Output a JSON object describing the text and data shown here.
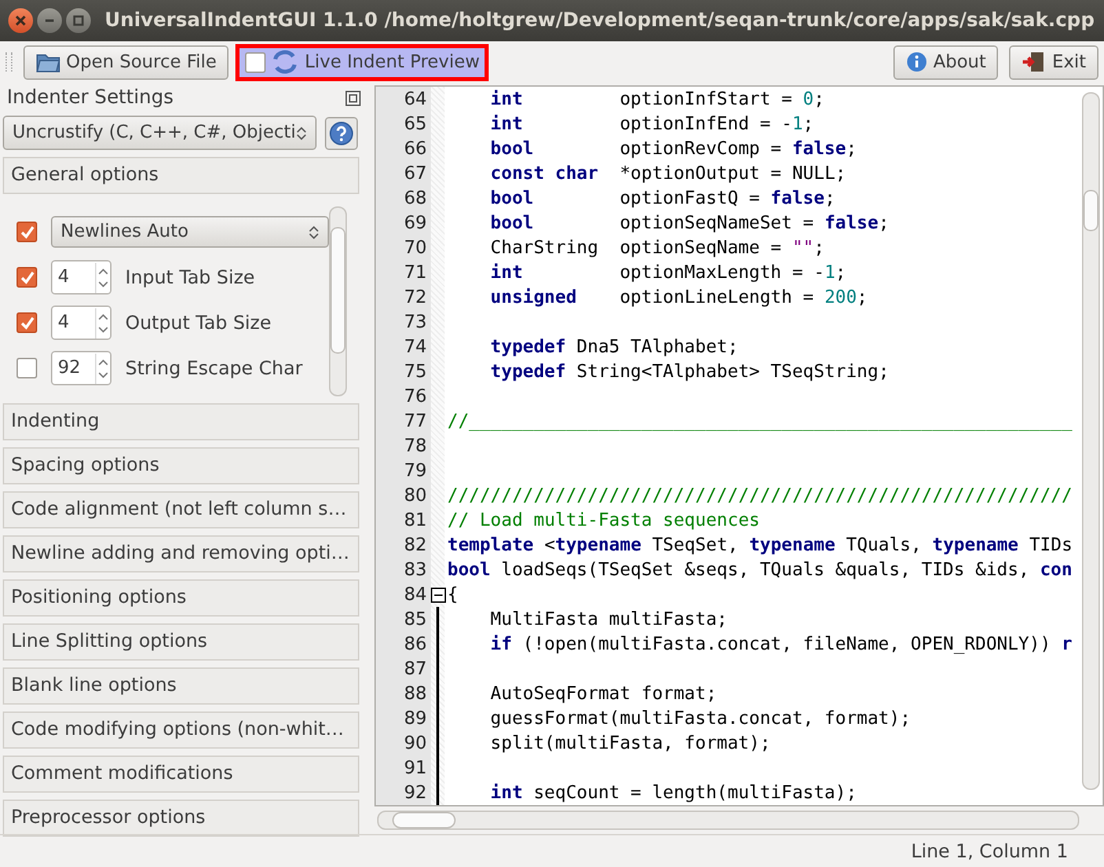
{
  "window": {
    "title": "UniversalIndentGUI 1.1.0 /home/holtgrew/Development/seqan-trunk/core/apps/sak/sak.cpp"
  },
  "toolbar": {
    "open_button": "Open Source File",
    "live_preview": {
      "label": "Live Indent Preview",
      "checked": false,
      "highlighted": true
    },
    "about_button": "About",
    "exit_button": "Exit"
  },
  "indenter": {
    "title": "Indenter Settings",
    "selector": "Uncrustify (C, C++, C#, Objecti",
    "sections": [
      {
        "title": "General options",
        "options": [
          {
            "kind": "combo",
            "checked": true,
            "value": "Newlines Auto"
          },
          {
            "kind": "spin",
            "checked": true,
            "value": "4",
            "label": "Input Tab Size"
          },
          {
            "kind": "spin",
            "checked": true,
            "value": "4",
            "label": "Output Tab Size"
          },
          {
            "kind": "spin",
            "checked": false,
            "value": "92",
            "label": "String Escape Char"
          }
        ]
      },
      {
        "title": "Indenting"
      },
      {
        "title": "Spacing options"
      },
      {
        "title": "Code alignment (not left column s…"
      },
      {
        "title": "Newline adding and removing opti…"
      },
      {
        "title": "Positioning options"
      },
      {
        "title": "Line Splitting options"
      },
      {
        "title": "Blank line options"
      },
      {
        "title": "Code modifying options (non-whit…"
      },
      {
        "title": "Comment modifications"
      },
      {
        "title": "Preprocessor options"
      }
    ]
  },
  "editor": {
    "lines": [
      {
        "number": "64",
        "indented": true,
        "tokens": [
          {
            "kind": "kw",
            "text": "int"
          },
          {
            "kind": "plain",
            "text": "         optionInfStart = "
          },
          {
            "kind": "num",
            "text": "0"
          },
          {
            "kind": "plain",
            "text": ";"
          }
        ]
      },
      {
        "number": "65",
        "indented": true,
        "tokens": [
          {
            "kind": "kw",
            "text": "int"
          },
          {
            "kind": "plain",
            "text": "         optionInfEnd = -"
          },
          {
            "kind": "num",
            "text": "1"
          },
          {
            "kind": "plain",
            "text": ";"
          }
        ]
      },
      {
        "number": "66",
        "indented": true,
        "tokens": [
          {
            "kind": "kw",
            "text": "bool"
          },
          {
            "kind": "plain",
            "text": "        optionRevComp = "
          },
          {
            "kind": "kw",
            "text": "false"
          },
          {
            "kind": "plain",
            "text": ";"
          }
        ]
      },
      {
        "number": "67",
        "indented": true,
        "tokens": [
          {
            "kind": "kw",
            "text": "const char"
          },
          {
            "kind": "plain",
            "text": "  *optionOutput = NULL;"
          }
        ]
      },
      {
        "number": "68",
        "indented": true,
        "tokens": [
          {
            "kind": "kw",
            "text": "bool"
          },
          {
            "kind": "plain",
            "text": "        optionFastQ = "
          },
          {
            "kind": "kw",
            "text": "false"
          },
          {
            "kind": "plain",
            "text": ";"
          }
        ]
      },
      {
        "number": "69",
        "indented": true,
        "tokens": [
          {
            "kind": "kw",
            "text": "bool"
          },
          {
            "kind": "plain",
            "text": "        optionSeqNameSet = "
          },
          {
            "kind": "kw",
            "text": "false"
          },
          {
            "kind": "plain",
            "text": ";"
          }
        ]
      },
      {
        "number": "70",
        "indented": true,
        "tokens": [
          {
            "kind": "plain",
            "text": "CharString  optionSeqName = "
          },
          {
            "kind": "str",
            "text": "\"\""
          },
          {
            "kind": "plain",
            "text": ";"
          }
        ]
      },
      {
        "number": "71",
        "indented": true,
        "tokens": [
          {
            "kind": "kw",
            "text": "int"
          },
          {
            "kind": "plain",
            "text": "         optionMaxLength = -"
          },
          {
            "kind": "num",
            "text": "1"
          },
          {
            "kind": "plain",
            "text": ";"
          }
        ]
      },
      {
        "number": "72",
        "indented": true,
        "tokens": [
          {
            "kind": "kw",
            "text": "unsigned"
          },
          {
            "kind": "plain",
            "text": "    optionLineLength = "
          },
          {
            "kind": "num",
            "text": "200"
          },
          {
            "kind": "plain",
            "text": ";"
          }
        ]
      },
      {
        "number": "73"
      },
      {
        "number": "74",
        "indented": true,
        "tokens": [
          {
            "kind": "kw",
            "text": "typedef"
          },
          {
            "kind": "plain",
            "text": " Dna5 TAlphabet;"
          }
        ]
      },
      {
        "number": "75",
        "indented": true,
        "tokens": [
          {
            "kind": "kw",
            "text": "typedef"
          },
          {
            "kind": "plain",
            "text": " String<TAlphabet> TSeqString;"
          }
        ]
      },
      {
        "number": "76"
      },
      {
        "number": "77",
        "tokens": [
          {
            "kind": "cm",
            "text": "//________________________________________________________"
          }
        ]
      },
      {
        "number": "78"
      },
      {
        "number": "79"
      },
      {
        "number": "80",
        "tokens": [
          {
            "kind": "cm",
            "text": "//////////////////////////////////////////////////////////"
          }
        ]
      },
      {
        "number": "81",
        "tokens": [
          {
            "kind": "cm",
            "text": "// Load multi-Fasta sequences"
          }
        ]
      },
      {
        "number": "82",
        "tokens": [
          {
            "kind": "kw",
            "text": "template"
          },
          {
            "kind": "plain",
            "text": " <"
          },
          {
            "kind": "kw",
            "text": "typename"
          },
          {
            "kind": "plain",
            "text": " TSeqSet, "
          },
          {
            "kind": "kw",
            "text": "typename"
          },
          {
            "kind": "plain",
            "text": " TQuals, "
          },
          {
            "kind": "kw",
            "text": "typename"
          },
          {
            "kind": "plain",
            "text": " TIDs"
          }
        ]
      },
      {
        "number": "83",
        "tokens": [
          {
            "kind": "kw",
            "text": "bool"
          },
          {
            "kind": "plain",
            "text": " loadSeqs(TSeqSet &seqs, TQuals &quals, TIDs &ids, "
          },
          {
            "kind": "kw",
            "text": "con"
          }
        ]
      },
      {
        "number": "84",
        "expanded": true,
        "tokens": [
          {
            "kind": "plain",
            "text": "{"
          }
        ]
      },
      {
        "number": "85",
        "indented": true,
        "tokens": [
          {
            "kind": "plain",
            "text": "MultiFasta multiFasta;"
          }
        ]
      },
      {
        "number": "86",
        "indented": true,
        "tokens": [
          {
            "kind": "kw",
            "text": "if"
          },
          {
            "kind": "plain",
            "text": " (!open(multiFasta.concat, fileName, OPEN_RDONLY)) "
          },
          {
            "kind": "kw",
            "text": "r"
          }
        ]
      },
      {
        "number": "87"
      },
      {
        "number": "88",
        "indented": true,
        "tokens": [
          {
            "kind": "plain",
            "text": "AutoSeqFormat format;"
          }
        ]
      },
      {
        "number": "89",
        "indented": true,
        "tokens": [
          {
            "kind": "plain",
            "text": "guessFormat(multiFasta.concat, format);"
          }
        ]
      },
      {
        "number": "90",
        "indented": true,
        "tokens": [
          {
            "kind": "plain",
            "text": "split(multiFasta, format);"
          }
        ]
      },
      {
        "number": "91"
      },
      {
        "number": "92",
        "indented": true,
        "tokens": [
          {
            "kind": "kw",
            "text": "int"
          },
          {
            "kind": "plain",
            "text": " seqCount = length(multiFasta);"
          }
        ]
      }
    ]
  },
  "status_bar": {
    "position": "Line 1, Column 1"
  }
}
